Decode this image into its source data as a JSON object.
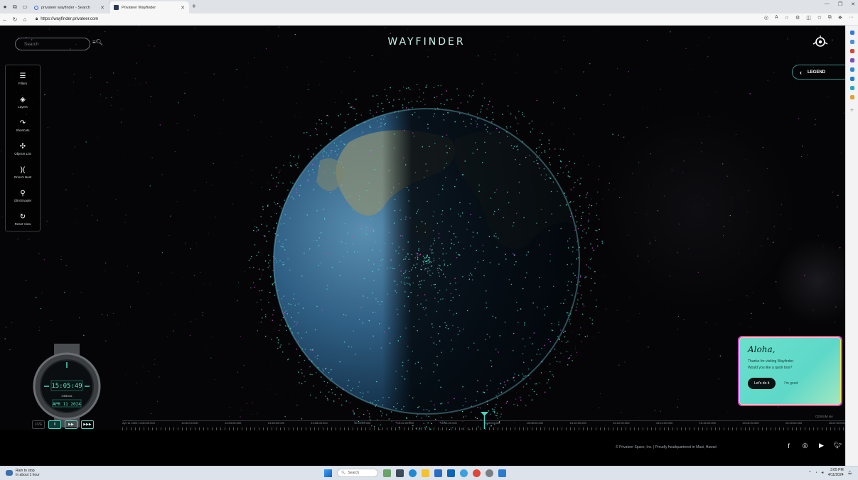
{
  "browser": {
    "tabs": [
      {
        "label": "privateer wayfinder - Search"
      },
      {
        "label": "Privateer Wayfinder"
      }
    ],
    "url": "https://wayfinder.privateer.com"
  },
  "app": {
    "search_placeholder": "Search",
    "brand": "WAYFINDER",
    "legend_label": "LEGEND",
    "tools": [
      {
        "label": "Filters",
        "icon": "filters-icon"
      },
      {
        "label": "Layers",
        "icon": "layers-icon"
      },
      {
        "label": "Shortcuts",
        "icon": "shortcuts-icon"
      },
      {
        "label": "Objects List",
        "icon": "objects-list-icon"
      },
      {
        "label": "Orion's Nest",
        "icon": "orions-nest-icon"
      },
      {
        "label": "Glint Evader",
        "icon": "glint-evader-icon"
      },
      {
        "label": "Reset View",
        "icon": "reset-view-icon"
      }
    ],
    "watch": {
      "time": "15:05:49",
      "date": "APR 11 2024",
      "brand": "OMEGA"
    },
    "playback": {
      "live": "LIVE",
      "pause": "II",
      "ff": "▶▶",
      "fff": "▶▶▶"
    },
    "timeline": {
      "labels": [
        "Apr 11 2024 14:50:00.000",
        "14:52:00.000",
        "14:54:00.000",
        "14:56:00.000",
        "14:58:00.000",
        "15:00:00.000",
        "15:02:00.000",
        "15:04:00.000",
        "15:06:00.000",
        "15:08:00.000",
        "15:10:00.000",
        "15:12:00.000",
        "15:14:00.000",
        "15:16:00.000",
        "15:18:00.000",
        "15:20:00.000",
        "15:22:00.000"
      ]
    },
    "cesium": "CESIUM ion",
    "tour": {
      "title": "Aloha,",
      "line1": "Thanks for visiting Wayfinder.",
      "line2": "Would you like a quick tour?",
      "accept": "Let's do it",
      "decline": "I'm good"
    },
    "footer": {
      "copyright": "© Privateer Space, Inc. | Proudly headquartered in Maui, Hawaii",
      "socials": [
        "facebook-icon",
        "instagram-icon",
        "youtube-icon",
        "twitter-icon",
        "alert-icon"
      ]
    },
    "colors": {
      "accent": "#4fd1bf",
      "debris": "#d64ad1",
      "tour_bg": "#5ed8c9"
    }
  },
  "taskbar": {
    "weather_line1": "Rain to stop",
    "weather_line2": "In about 1 hour",
    "search": "Search",
    "time": "3:05 PM",
    "date": "4/11/2024"
  }
}
